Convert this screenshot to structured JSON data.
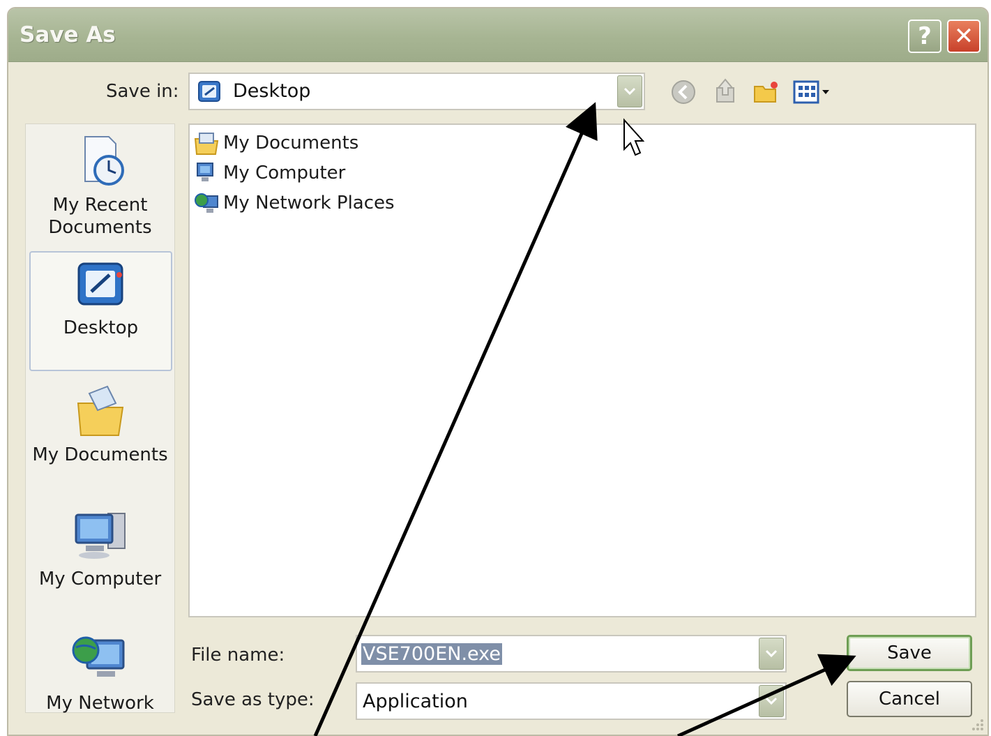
{
  "window": {
    "title": "Save As"
  },
  "titlebar": {
    "help_label": "?",
    "close_label": "✕"
  },
  "toolbar": {
    "save_in_label": "Save in:",
    "save_in_value": "Desktop",
    "icons": [
      "back-icon",
      "up-folder-icon",
      "new-folder-icon",
      "views-menu-icon"
    ]
  },
  "places": [
    {
      "label_line1": "My Recent",
      "label_line2": "Documents",
      "icon": "recent-documents-icon"
    },
    {
      "label_line1": "Desktop",
      "label_line2": "",
      "icon": "desktop-icon"
    },
    {
      "label_line1": "My Documents",
      "label_line2": "",
      "icon": "my-documents-icon"
    },
    {
      "label_line1": "My Computer",
      "label_line2": "",
      "icon": "my-computer-icon"
    },
    {
      "label_line1": "My Network",
      "label_line2": "",
      "icon": "my-network-icon"
    }
  ],
  "files": [
    {
      "name": "My Documents",
      "icon": "my-documents-icon"
    },
    {
      "name": "My Computer",
      "icon": "my-computer-icon"
    },
    {
      "name": "My Network Places",
      "icon": "my-network-places-icon"
    }
  ],
  "form": {
    "file_name_label": "File name:",
    "file_name_value": "VSE700EN.exe",
    "save_as_type_label": "Save as type:",
    "save_as_type_value": "Application"
  },
  "buttons": {
    "save": "Save",
    "cancel": "Cancel"
  },
  "colors": {
    "titlebar": "#a7b593",
    "dialog_bg": "#ece9d8",
    "default_button_border": "#6e9e54"
  }
}
